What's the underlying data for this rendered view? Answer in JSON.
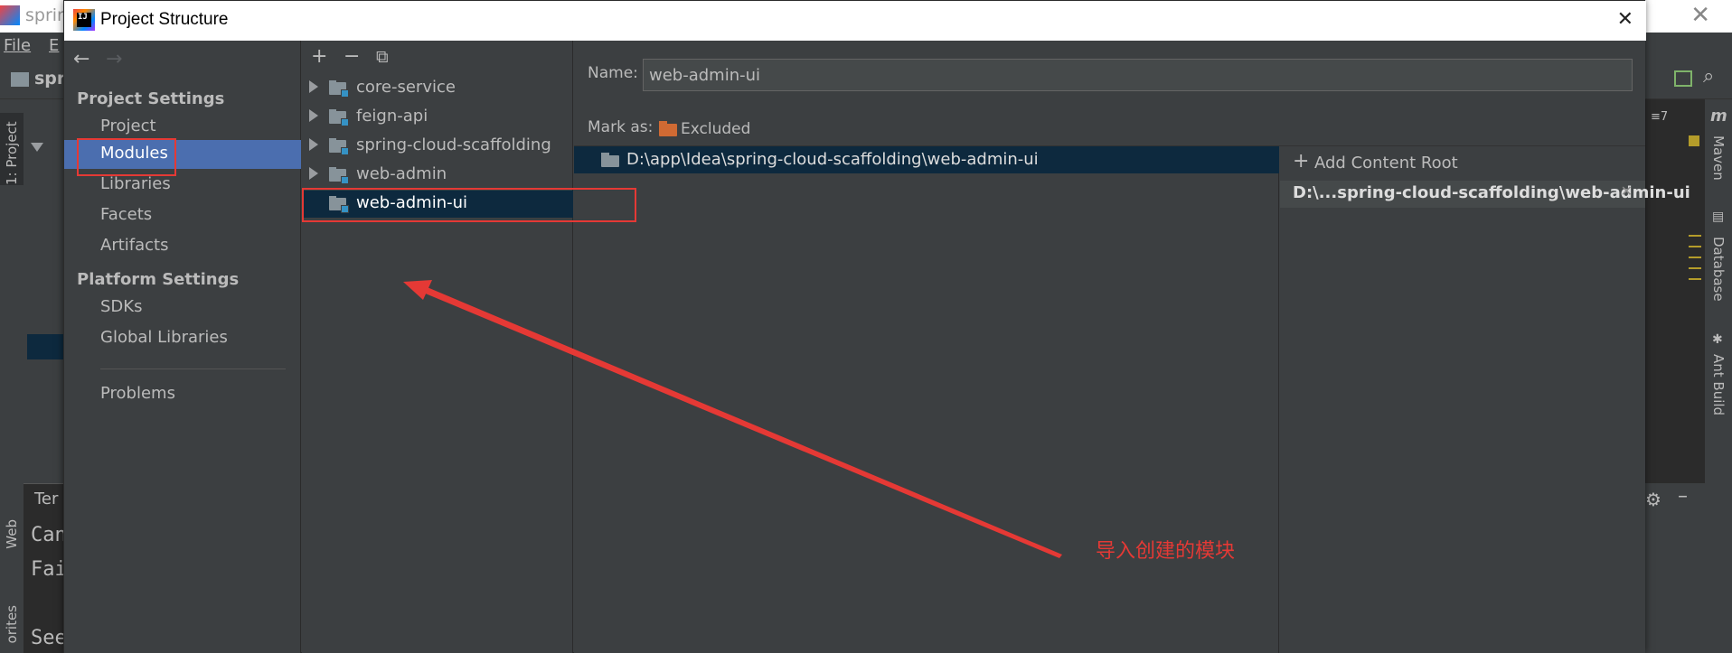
{
  "background_ide": {
    "window_title": "sprin",
    "menu": [
      "File",
      "E"
    ],
    "project_name": "spr",
    "left_tools": [
      "1: Project",
      "Web",
      "orites"
    ],
    "terminal_tab": "Ter",
    "terminal_lines": [
      "Can",
      "Fai",
      "See"
    ],
    "right_tools": [
      "Maven",
      "Database",
      "Ant Build"
    ],
    "structure_badge": "7"
  },
  "dialog": {
    "title": "Project Structure",
    "close_glyph": "✕"
  },
  "nav": {
    "back_glyph": "←",
    "forward_glyph": "→",
    "project_settings_header": "Project Settings",
    "project_settings_items": [
      "Project",
      "Modules",
      "Libraries",
      "Facets",
      "Artifacts"
    ],
    "platform_settings_header": "Platform Settings",
    "platform_settings_items": [
      "SDKs",
      "Global Libraries"
    ],
    "problems": "Problems",
    "selected": "Modules"
  },
  "toolbar": {
    "add_glyph": "+",
    "remove_glyph": "−",
    "copy_glyph": "⧉"
  },
  "modules": [
    {
      "name": "core-service",
      "expandable": true
    },
    {
      "name": "feign-api",
      "expandable": true
    },
    {
      "name": "spring-cloud-scaffolding",
      "expandable": true
    },
    {
      "name": "web-admin",
      "expandable": true
    },
    {
      "name": "web-admin-ui",
      "expandable": false,
      "selected": true
    }
  ],
  "content": {
    "name_label": "Name:",
    "name_value": "web-admin-ui",
    "mark_as_label": "Mark as:",
    "excluded_label": "Excluded",
    "folder_path": "D:\\app\\Idea\\spring-cloud-scaffolding\\web-admin-ui",
    "add_content_root_glyph": "+",
    "add_content_root": "Add Content Root",
    "content_root_path": "D:\\...spring-cloud-scaffolding\\web-admin-ui",
    "remove_glyph": "✕"
  },
  "annotation": {
    "text": "导入创建的模块",
    "color": "#e53935"
  },
  "colors": {
    "dialog_bg": "#3c3f41",
    "selection": "#4b6eaf",
    "tree_selection": "#0d293e",
    "excluded_folder": "#d06a33",
    "module_badge": "#3592c4"
  }
}
